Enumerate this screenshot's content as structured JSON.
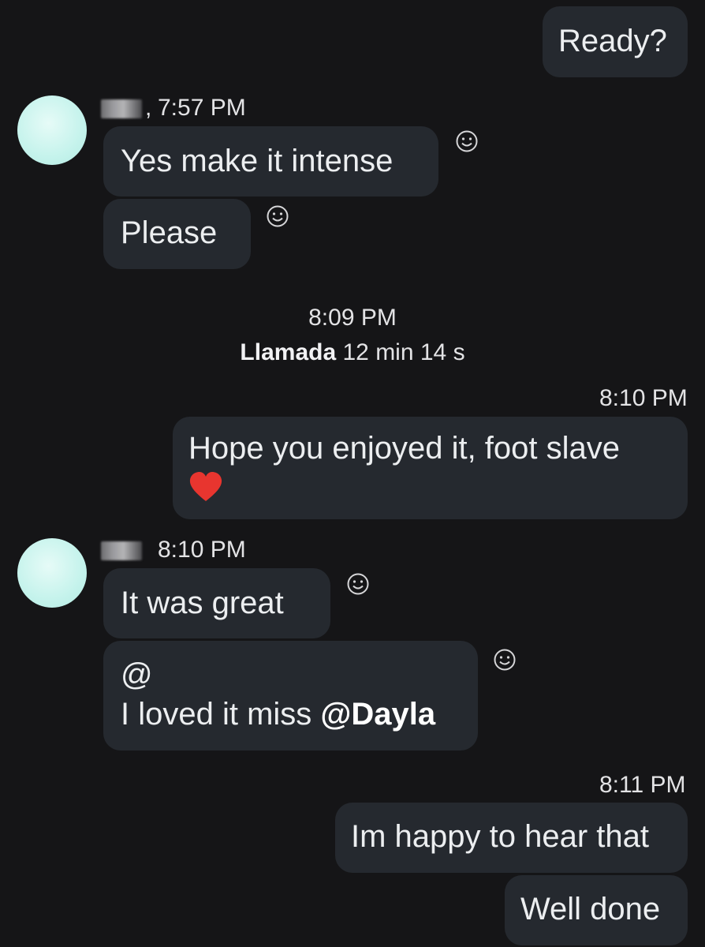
{
  "messages": {
    "m1": {
      "text": "Ready?",
      "side": "outgoing"
    },
    "group1": {
      "time": "7:57 PM",
      "separator": ",",
      "m2": {
        "text": "Yes make it intense"
      },
      "m3": {
        "text": "Please"
      }
    },
    "call": {
      "time": "8:09 PM",
      "label": "Llamada",
      "duration": "12 min 14 s"
    },
    "group2": {
      "time": "8:10 PM",
      "m4": {
        "line1": "Hope you enjoyed it, foot slave",
        "emoji": "❤"
      }
    },
    "group3": {
      "time": "8:10 PM",
      "m5": {
        "text": "It was great"
      },
      "m6": {
        "line1": "@",
        "line2_text": "I loved it miss ",
        "mention": "@Dayla"
      }
    },
    "group4": {
      "time": "8:11 PM",
      "m7": {
        "text": "Im happy to hear that"
      },
      "m8": {
        "text": "Well done"
      }
    }
  },
  "icons": {
    "reaction": "smiley-reaction-icon",
    "avatar": "avatar-placeholder"
  },
  "colors": {
    "background": "#151517",
    "bubble": "#25292f",
    "heart": "#e8352f",
    "avatar": "#c5f3ec"
  }
}
